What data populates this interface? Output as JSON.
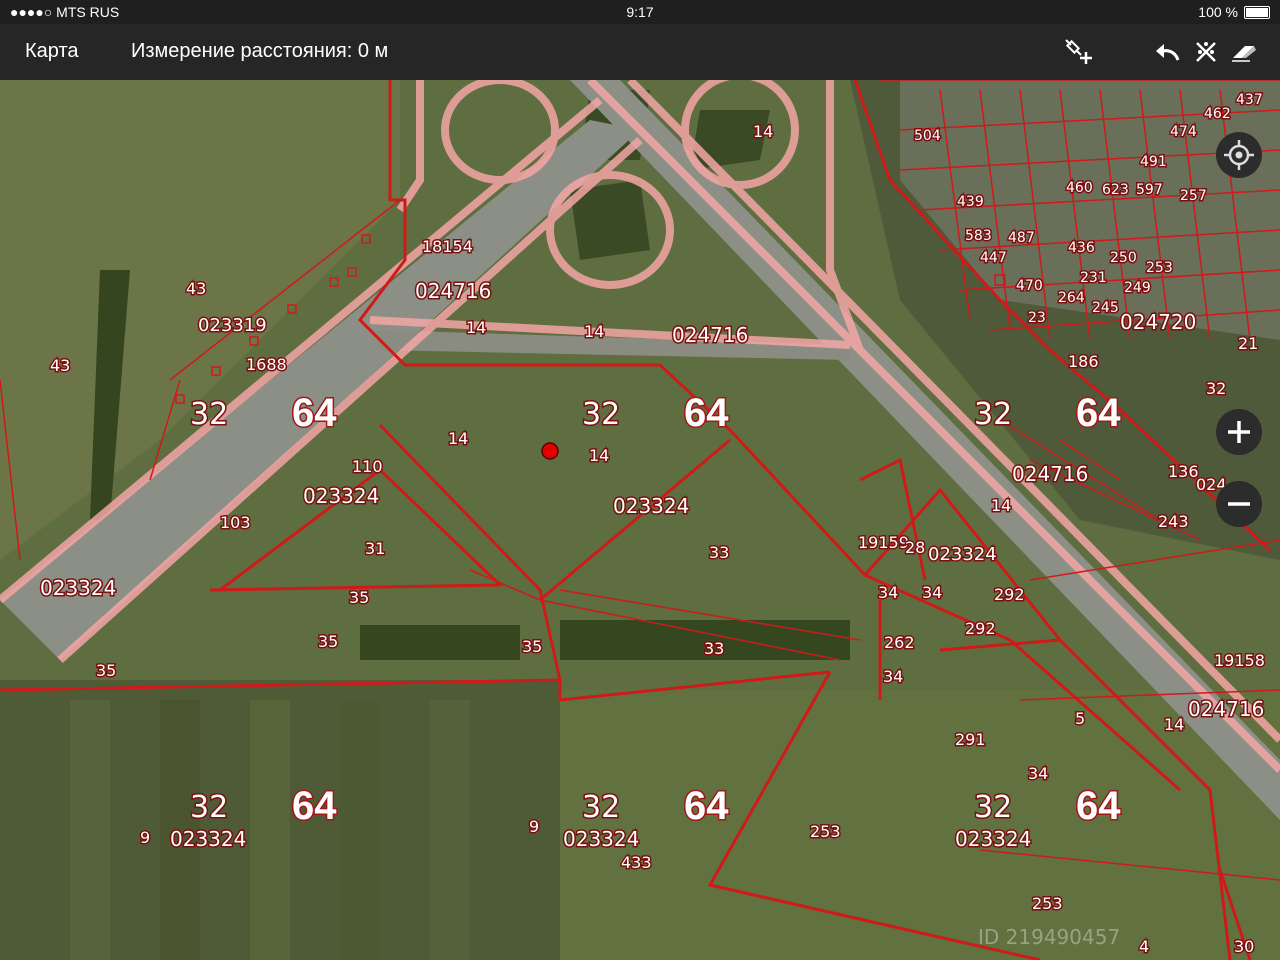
{
  "status_bar": {
    "carrier": "●●●●○ MTS RUS",
    "time": "9:17",
    "battery": "100 %"
  },
  "nav": {
    "back_label": "Карта",
    "title": "Измерение расстояния: 0 м"
  },
  "toolbar": {
    "icons": [
      "satellite-add-icon",
      "undo-icon",
      "remove-points-icon",
      "eraser-icon"
    ]
  },
  "map_controls": {
    "icons": [
      "locate-icon",
      "zoom-in-icon",
      "zoom-out-icon"
    ]
  },
  "watermark": "ID 219490457",
  "map": {
    "cadastral_labels": [
      "43",
      "023319",
      "43",
      "1688",
      "18154",
      "024716",
      "14",
      "14",
      "024716",
      "14",
      "32",
      "64",
      "32",
      "64",
      "14",
      "14",
      "023324",
      "110",
      "023324",
      "103",
      "31",
      "35",
      "35",
      "35",
      "33",
      "33",
      "023324",
      "35",
      "19159",
      "28",
      "023324",
      "34",
      "34",
      "292",
      "292",
      "262",
      "34",
      "5",
      "291",
      "34",
      "14",
      "19158",
      "024716",
      "32",
      "64",
      "9",
      "023324",
      "9",
      "32",
      "64",
      "023324",
      "433",
      "253",
      "32",
      "64",
      "023324",
      "253",
      "4",
      "30",
      "32",
      "64",
      "024716",
      "136",
      "024",
      "243",
      "14",
      "186",
      "024720",
      "21",
      "32",
      "439",
      "583",
      "447",
      "487",
      "436",
      "460",
      "623",
      "597",
      "257",
      "474",
      "470",
      "23",
      "264",
      "245",
      "249",
      "253",
      "250",
      "231",
      "491",
      "504",
      "462",
      "437"
    ]
  },
  "colors": {
    "boundary": "#d01a1a",
    "road_buffer": "#f4a6a6",
    "bar_bg": "#262626",
    "status_bg": "#1f1f1f",
    "point": "#e00000"
  }
}
